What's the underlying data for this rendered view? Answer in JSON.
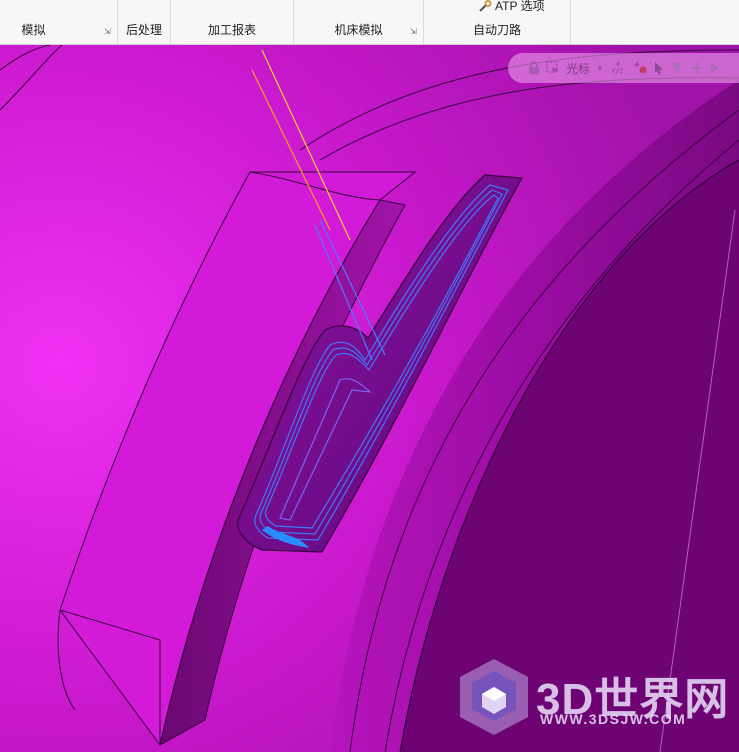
{
  "ribbon": {
    "groups": [
      {
        "label": "模拟",
        "has_launcher": true
      },
      {
        "label": "后处理",
        "has_launcher": false
      },
      {
        "label": "加工报表",
        "has_launcher": false
      },
      {
        "label": "机床模拟",
        "has_launcher": true
      },
      {
        "label": "自动刀路",
        "has_launcher": false
      }
    ],
    "atp_options_label": "ATP 选项"
  },
  "view_toolbar": {
    "cursor_label": "光标",
    "icons": [
      "lock-icon",
      "cursor-select-icon",
      "xyz-coordinate-icon",
      "add-point-icon",
      "pointer-icon",
      "filter-icon",
      "pan-icon",
      "play-icon"
    ]
  },
  "watermark": {
    "title": "3D世界网",
    "subtitle": "WWW.3DSJW.COM"
  },
  "colors": {
    "part_face": "#d21ad8",
    "part_dark": "#7a0a82",
    "toolpath": "#3f7dff",
    "tool_axis": "#f0d030"
  }
}
